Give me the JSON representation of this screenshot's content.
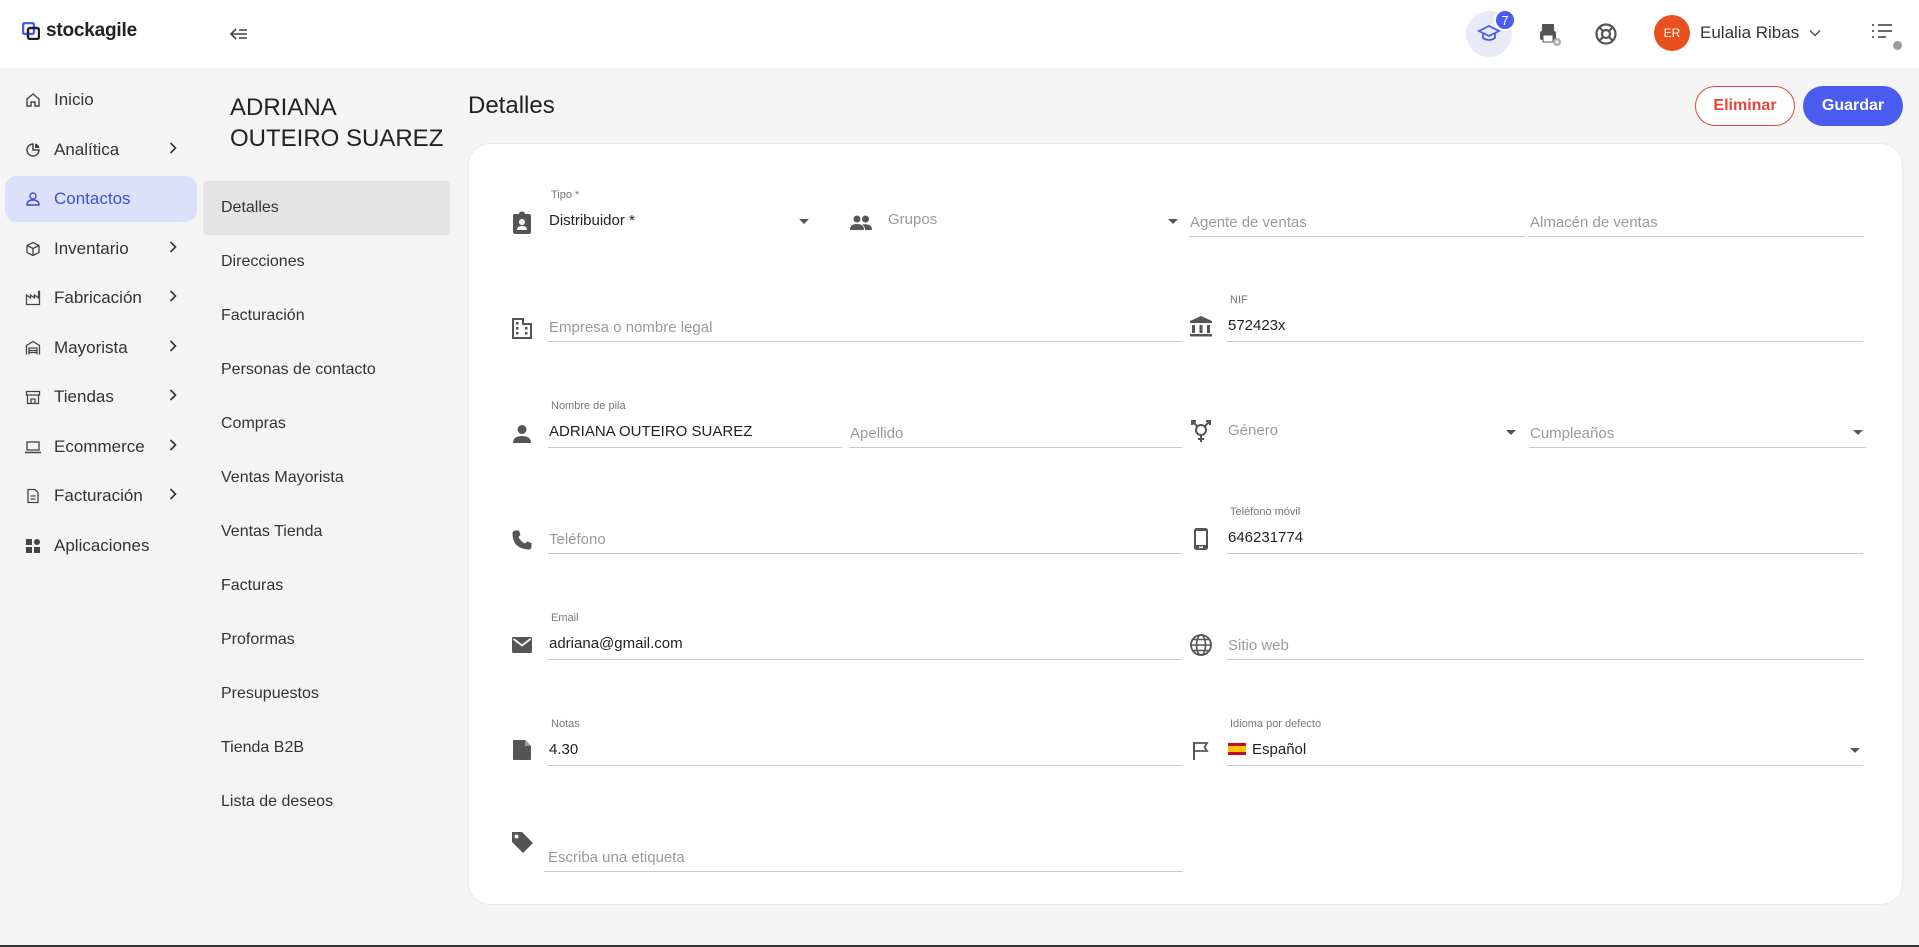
{
  "app": {
    "logo_text": "stockagile"
  },
  "topbar": {
    "learn_badge": "7",
    "user": {
      "initials": "ER",
      "name": "Eulalia Ribas"
    }
  },
  "sidebar": {
    "items": [
      {
        "label": "Inicio",
        "icon": "home-icon"
      },
      {
        "label": "Analítica",
        "icon": "analytics-icon"
      },
      {
        "label": "Contactos",
        "icon": "person-icon"
      },
      {
        "label": "Inventario",
        "icon": "box-icon"
      },
      {
        "label": "Fabricación",
        "icon": "factory-icon"
      },
      {
        "label": "Mayorista",
        "icon": "warehouse-icon"
      },
      {
        "label": "Tiendas",
        "icon": "store-icon"
      },
      {
        "label": "Ecommerce",
        "icon": "laptop-icon"
      },
      {
        "label": "Facturación",
        "icon": "document-icon"
      },
      {
        "label": "Aplicaciones",
        "icon": "apps-icon"
      }
    ]
  },
  "contact": {
    "name": "ADRIANA OUTEIRO SUAREZ"
  },
  "subnav": {
    "items": [
      "Detalles",
      "Direcciones",
      "Facturación",
      "Personas de contacto",
      "Compras",
      "Ventas Mayorista",
      "Ventas Tienda",
      "Facturas",
      "Proformas",
      "Presupuestos",
      "Tienda B2B",
      "Lista de deseos"
    ]
  },
  "main": {
    "title": "Detalles",
    "delete_label": "Eliminar",
    "save_label": "Guardar"
  },
  "form": {
    "tipo": {
      "label": "Tipo *",
      "value": "Distribuidor *"
    },
    "grupos": {
      "placeholder": "Grupos"
    },
    "agente": {
      "placeholder": "Agente de ventas"
    },
    "almacen": {
      "placeholder": "Almacén de ventas"
    },
    "empresa": {
      "placeholder": "Empresa o nombre legal"
    },
    "nif": {
      "label": "NIF",
      "value": "572423x"
    },
    "nombre": {
      "label": "Nombre de pila",
      "value": "ADRIANA OUTEIRO SUAREZ"
    },
    "apellido": {
      "placeholder": "Apellido"
    },
    "genero": {
      "placeholder": "Género"
    },
    "cumple": {
      "placeholder": "Cumpleaños"
    },
    "telefono": {
      "placeholder": "Teléfono"
    },
    "movil": {
      "label": "Teléfono móvil",
      "value": "646231774"
    },
    "email": {
      "label": "Email",
      "value": "adriana@gmail.com"
    },
    "web": {
      "placeholder": "Sitio web"
    },
    "notas": {
      "label": "Notas",
      "value": "4.30"
    },
    "idioma": {
      "label": "Idioma por defecto",
      "value": "Español"
    },
    "etiqueta": {
      "placeholder": "Escriba una etiqueta"
    }
  },
  "colors": {
    "accent": "#4a5cf0",
    "danger": "#e0483b",
    "active_nav_bg": "#dde0fa"
  }
}
